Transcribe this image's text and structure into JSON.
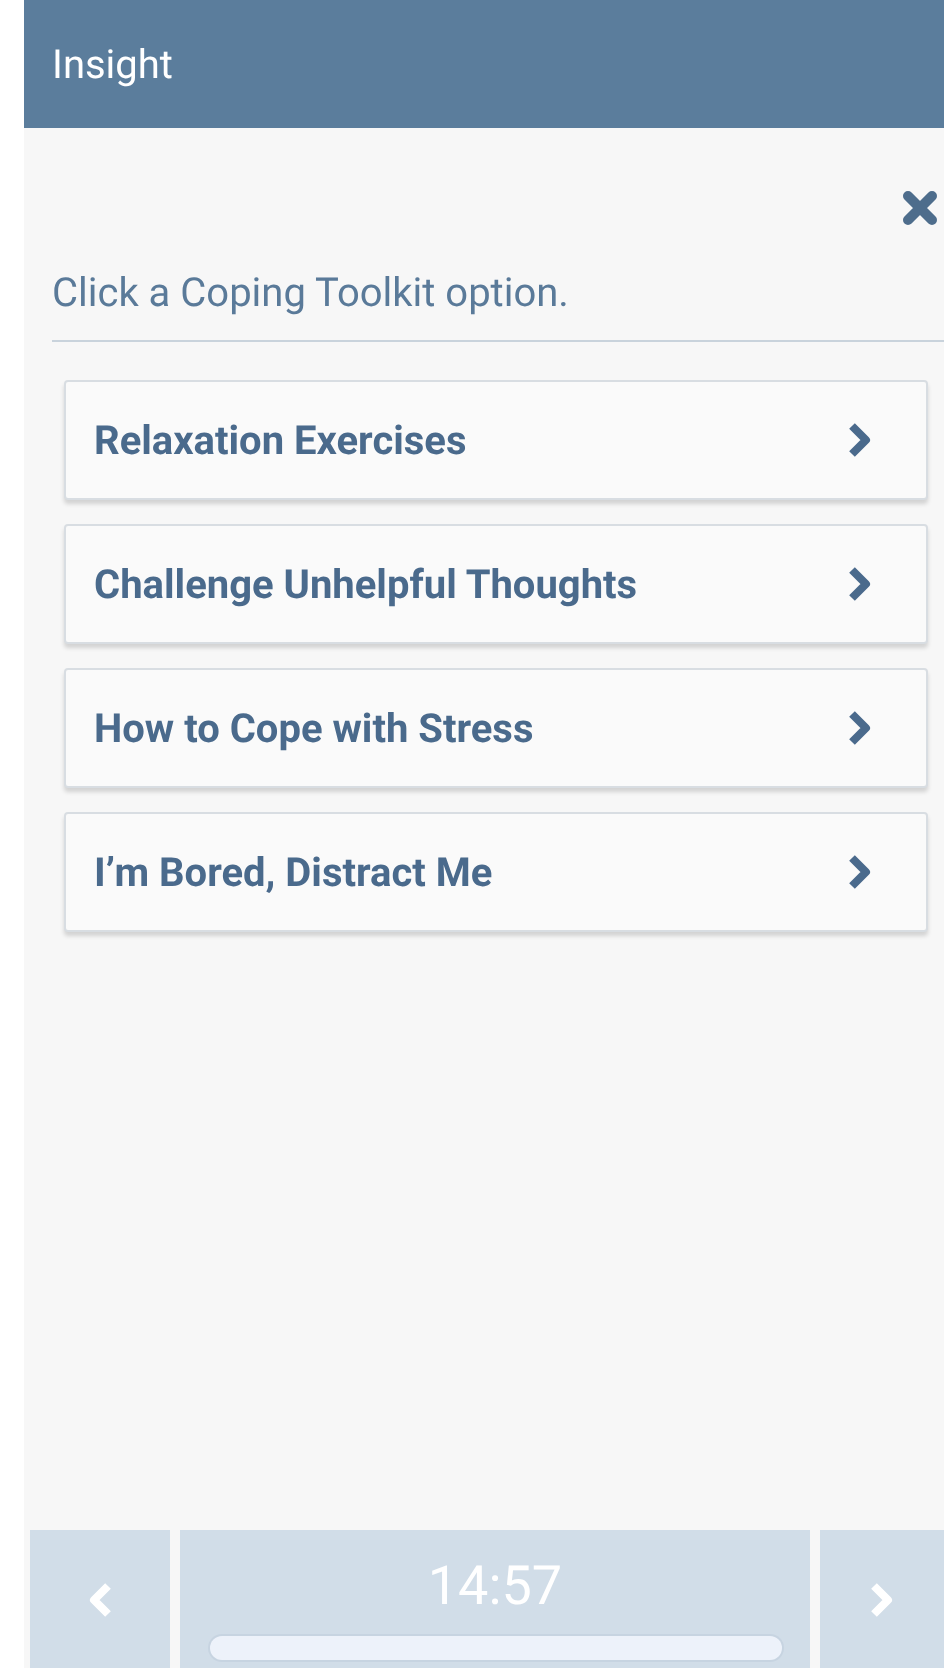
{
  "header": {
    "title": "Insight"
  },
  "prompt": "Click a Coping Toolkit option.",
  "options": [
    {
      "label": "Relaxation Exercises"
    },
    {
      "label": "Challenge Unhelpful Thoughts"
    },
    {
      "label": "How to Cope with Stress"
    },
    {
      "label": "I’m Bored, Distract Me"
    }
  ],
  "footer": {
    "time": "14:57",
    "progress": {
      "level": 1
    }
  }
}
